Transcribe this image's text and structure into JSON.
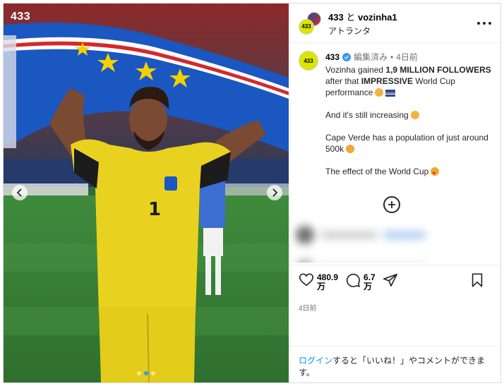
{
  "photo": {
    "watermark": "433",
    "jersey_number": "1",
    "carousel": {
      "count": 3,
      "active": 1
    }
  },
  "header": {
    "account": "433",
    "connector": "と",
    "collaborator": "vozinha1",
    "location": "アトランタ"
  },
  "post": {
    "username": "433",
    "edited": "編集済み",
    "separator": "•",
    "time": "4日前",
    "line1_a": "Vozinha gained ",
    "line1_b": "1,9 MILLION FOLLOWERS",
    "line1_c": " after that ",
    "line1_d": "IMPRESSIVE",
    "line1_e": " World Cup performance",
    "line2": "And it's still increasing",
    "line3": "Cape Verde has a population of just around 500k",
    "line4": "The effect of the World Cup"
  },
  "actions": {
    "likes": "480.9",
    "likes_unit": "万",
    "comments": "6.7",
    "comments_unit": "万",
    "date": "4日前"
  },
  "footer": {
    "login_link": "ログイン",
    "login_rest": "すると「いいね！」やコメントができます。"
  },
  "colors": {
    "accent": "#0095f6",
    "verified": "#3897f0",
    "brand_yellow": "#dbe600"
  }
}
